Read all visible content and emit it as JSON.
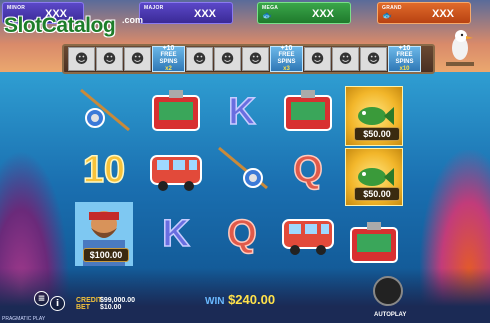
{
  "jackpots": [
    {
      "tag": "MINOR",
      "value": "XXX"
    },
    {
      "tag": "MAJOR",
      "value": "XXX"
    },
    {
      "tag": "MEGA",
      "value": "XXX"
    },
    {
      "tag": "GRAND",
      "value": "XXX"
    }
  ],
  "watermark": {
    "main": "SlotCatalog",
    "suffix": ".com"
  },
  "track": {
    "bonuses": [
      {
        "plus": "+10",
        "text": "FREE SPINS",
        "mult": "x2"
      },
      {
        "plus": "+10",
        "text": "FREE SPINS",
        "mult": "x3"
      },
      {
        "plus": "+10",
        "text": "FREE SPINS",
        "mult": "x10"
      }
    ]
  },
  "reels": {
    "money_values": [
      "$50.00",
      "$50.00",
      "$100.00"
    ],
    "letters": {
      "ten": "10",
      "k": "K",
      "q": "Q"
    }
  },
  "footer": {
    "credit_label": "CREDIT",
    "credit_value": "$99,000.00",
    "bet_label": "BET",
    "bet_value": "$10.00",
    "win_label": "WIN",
    "win_value": "$240.00",
    "autoplay_label": "AUTOPLAY",
    "brand": "PRAGMATIC PLAY"
  },
  "colors": {
    "accent": "#f3c23a",
    "sea": "#1a6fb0"
  }
}
